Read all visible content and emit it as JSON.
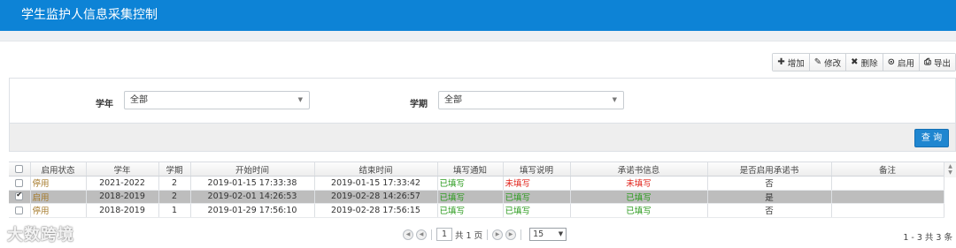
{
  "header": {
    "title": "学生监护人信息采集控制"
  },
  "toolbar": [
    {
      "icon": "plus-icon",
      "glyph": "✚",
      "label": "增加"
    },
    {
      "icon": "edit-icon",
      "glyph": "✎",
      "label": "修改"
    },
    {
      "icon": "delete-icon",
      "glyph": "✖",
      "label": "删除"
    },
    {
      "icon": "enable-icon",
      "glyph": "⊙",
      "label": "启用"
    },
    {
      "icon": "print-icon",
      "glyph": "⎙",
      "label": "导出"
    }
  ],
  "filters": {
    "year": {
      "label": "学年",
      "value": "全部"
    },
    "term": {
      "label": "学期",
      "value": "全部"
    },
    "query_label": "查 询"
  },
  "table": {
    "columns": [
      "启用状态",
      "学年",
      "学期",
      "开始时间",
      "结束时间",
      "填写通知",
      "填写说明",
      "承诺书信息",
      "是否启用承诺书",
      "备注"
    ],
    "rows": [
      {
        "checked": false,
        "status": "停用",
        "year": "2021-2022",
        "term": "2",
        "start": "2019-01-15 17:33:38",
        "end": "2019-01-15 17:33:42",
        "notice": "已填写",
        "notice_color": "green",
        "desc": "未填写",
        "desc_color": "red",
        "promise": "未填写",
        "promise_color": "red",
        "use_promise": "否",
        "remark": ""
      },
      {
        "checked": true,
        "status": "启用",
        "year": "2018-2019",
        "term": "2",
        "start": "2019-02-01 14:26:53",
        "end": "2019-02-28 14:26:57",
        "notice": "已填写",
        "notice_color": "green",
        "desc": "已填写",
        "desc_color": "green",
        "promise": "已填写",
        "promise_color": "green",
        "use_promise": "是",
        "remark": ""
      },
      {
        "checked": false,
        "status": "停用",
        "year": "2018-2019",
        "term": "1",
        "start": "2019-01-29 17:56:10",
        "end": "2019-02-28 17:56:15",
        "notice": "已填写",
        "notice_color": "green",
        "desc": "已填写",
        "desc_color": "green",
        "promise": "已填写",
        "promise_color": "green",
        "use_promise": "否",
        "remark": ""
      }
    ]
  },
  "pager": {
    "page": "1",
    "total_pages_text": "共 1 页",
    "page_size": "15",
    "info": "1 - 3   共 3 条"
  },
  "watermark": "大数跨境",
  "colors": {
    "header_bg": "#0d83d6",
    "query_btn": "#1f86d0",
    "filled": "#2a9a1c",
    "unfilled": "#e0221a"
  }
}
